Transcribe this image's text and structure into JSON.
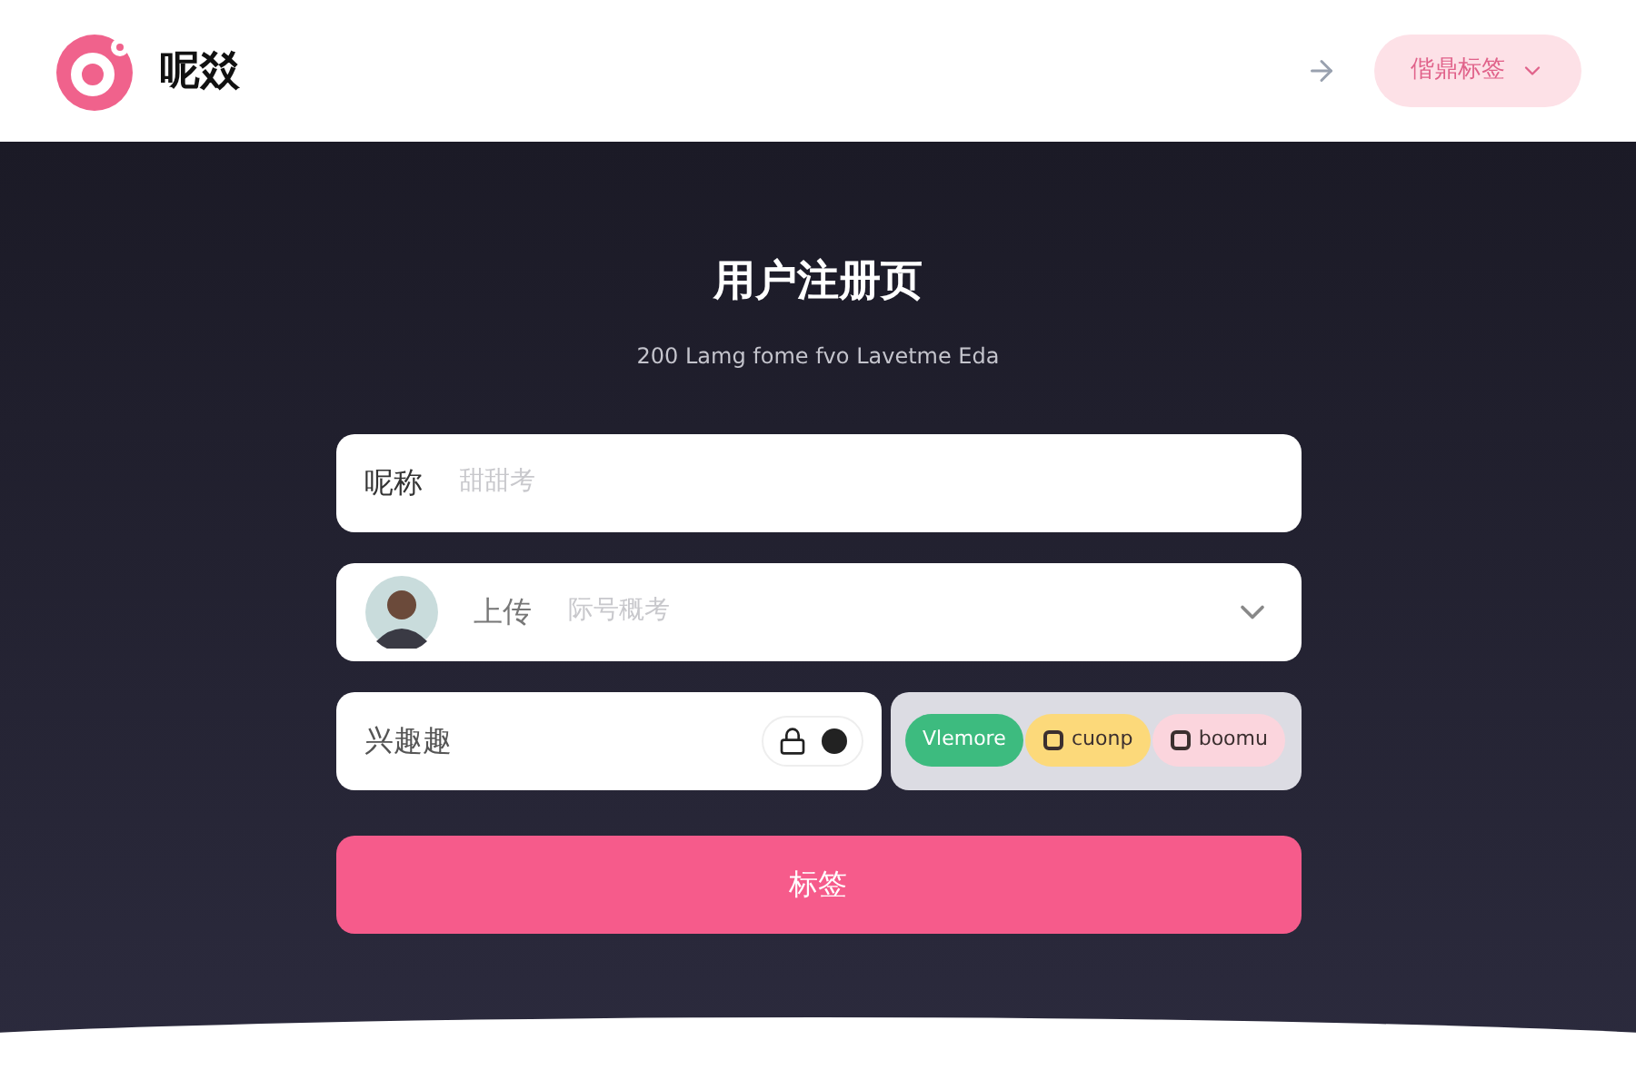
{
  "header": {
    "brand": "呢㸚",
    "language_button": "偕鼎标签"
  },
  "form": {
    "title": "用户注册页",
    "subtitle": "200 Lamg fome fvo Lavetme Eda",
    "nickname": {
      "label": "呢称",
      "placeholder": "甜甜考"
    },
    "avatar": {
      "label": "上传",
      "placeholder": "际号穊考"
    },
    "interests": {
      "label": "兴趣趣",
      "tags": [
        {
          "label": "Vlemore",
          "color": "#3dbb7f",
          "kind": "plain"
        },
        {
          "label": "cuonp",
          "color": "#fcd97a",
          "kind": "icon"
        },
        {
          "label": "boomu",
          "color": "#fbd5dd",
          "kind": "icon"
        }
      ]
    },
    "submit": "标签"
  }
}
